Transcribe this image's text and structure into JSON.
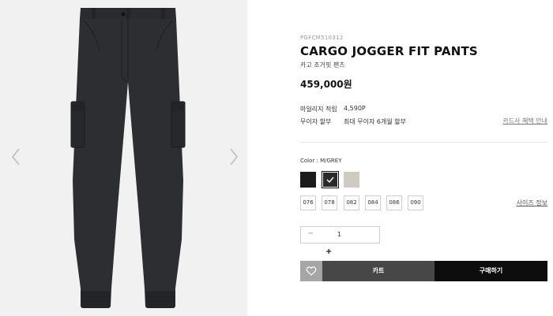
{
  "product": {
    "sku": "PGFCM510312",
    "name": "CARGO JOGGER FIT PANTS",
    "name_ko": "카고 조거핏 팬츠",
    "price": "459,000원"
  },
  "benefits": {
    "mileage_label": "마일리지 적립",
    "mileage_value": "4,590P",
    "installment_label": "무이자 할부",
    "installment_value": "최대 무이자 6개월 할부",
    "card_benefit_link": "카드사 혜택 안내"
  },
  "options": {
    "color_label": "Color : M/GREY",
    "swatch_colors": [
      "#1b1b1b",
      "#2a2a2a",
      "#cfcbc2"
    ],
    "selected_color_index": 1,
    "sizes": [
      "076",
      "078",
      "082",
      "084",
      "086",
      "090"
    ],
    "size_guide_link": "사이즈 정보"
  },
  "quantity": {
    "minus": "−",
    "value": "1",
    "add": "+"
  },
  "actions": {
    "cart_label": "카트",
    "buy_label": "구매하기"
  },
  "icons": {
    "prev": "chevron-left-icon",
    "next": "chevron-right-icon",
    "wishlist": "heart-icon",
    "check": "check-icon"
  },
  "colors": {
    "gallery_bg": "#f1f1f1",
    "cart_button": "#474747",
    "buy_button": "#0d0d0d",
    "wish_button": "#a6a6a6"
  }
}
